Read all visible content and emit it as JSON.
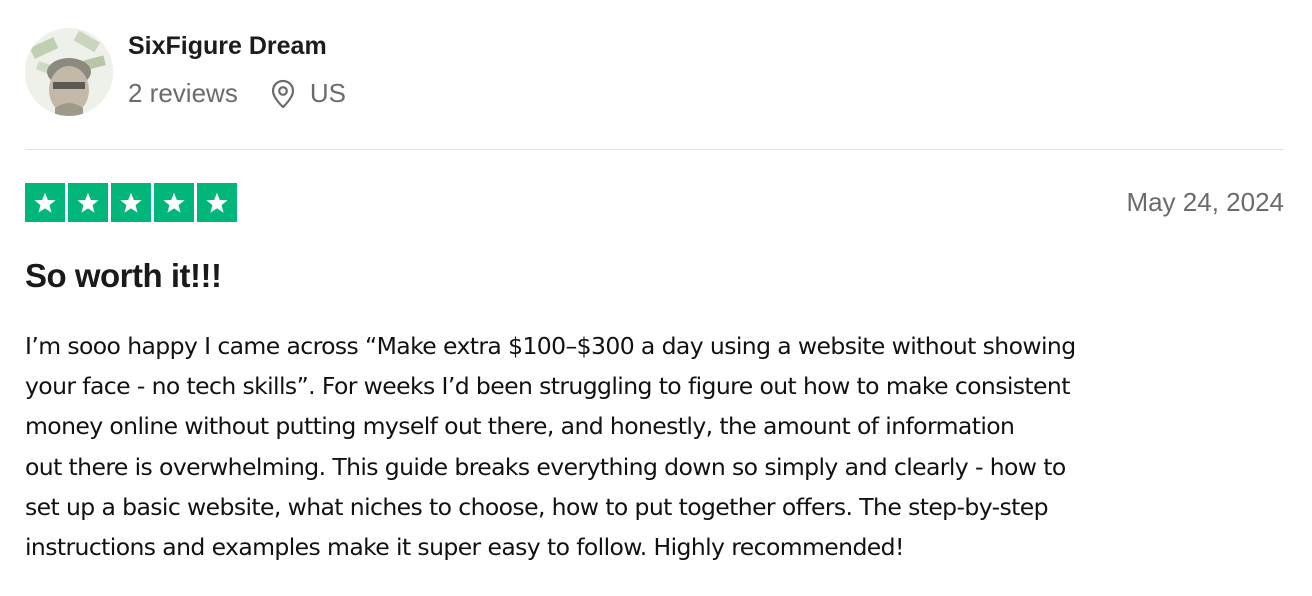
{
  "reviewer": {
    "name": "SixFigure Dream",
    "reviews_count": "2 reviews",
    "location": "US"
  },
  "review": {
    "rating": 5,
    "rating_max": 5,
    "star_color": "#00b67a",
    "date": "May 24, 2024",
    "title": "So worth it!!!",
    "body_lines": [
      "I’m sooo happy I came across “Make extra $100–$300 a day using a website without showing",
      "your face - no tech skills”. For weeks I’d been struggling to figure out how to make consistent",
      "money online without putting myself out there, and honestly, the amount of information",
      "out there is overwhelming. This guide breaks everything down so simply and clearly - how to",
      "set up a basic website, what niches to choose, how to put together offers. The step-by-step",
      "instructions and examples make it super easy to follow. Highly recommended!"
    ]
  },
  "icons": {
    "location": "location-pin-icon",
    "star": "star-icon"
  }
}
